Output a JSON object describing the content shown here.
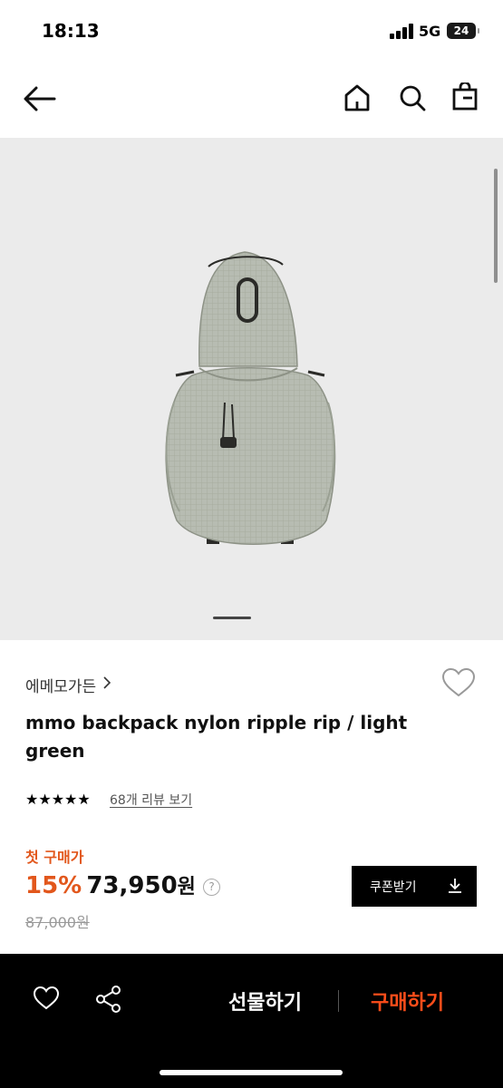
{
  "status_bar": {
    "time": "18:13",
    "network": "5G",
    "battery": "24"
  },
  "header": {
    "icons": [
      "back-arrow-icon",
      "home-icon",
      "search-icon",
      "shopping-bag-icon"
    ]
  },
  "gallery": {
    "image_subject": "light green nylon backpack"
  },
  "product": {
    "brand": "에메모가든",
    "title": "mmo backpack nylon ripple rip / light green",
    "stars": "★★★★★",
    "review_link": "68개 리뷰 보기",
    "first_purchase_label": "첫 구매가",
    "discount": "15%",
    "price": "73,950",
    "currency": "원",
    "help": "?",
    "original_price": "87,000원",
    "coupon_label": "쿠폰받기"
  },
  "bottom_bar": {
    "gift_label": "선물하기",
    "buy_label": "구매하기"
  },
  "colors": {
    "accent": "#e2571c",
    "buy": "#ff4d1a",
    "gallery_bg": "#ebebeb"
  }
}
